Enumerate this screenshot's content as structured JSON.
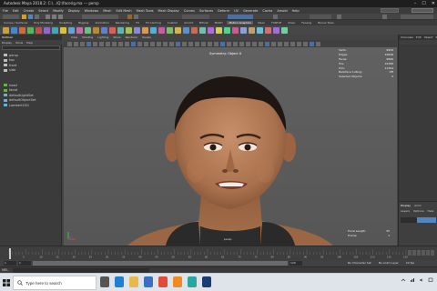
{
  "titlebar": {
    "title": "Autodesk Maya 2018.2: C:\\...\\Q:\\facerig.ma  ---  persp",
    "controls": [
      "–",
      "☐",
      "✕"
    ]
  },
  "menubar": {
    "items": [
      "File",
      "Edit",
      "Create",
      "Select",
      "Modify",
      "Display",
      "Windows",
      "Mesh",
      "Edit Mesh",
      "Mesh Tools",
      "Mesh Display",
      "Curves",
      "Surfaces",
      "Deform",
      "UV",
      "Generate",
      "Cache",
      "Arnold",
      "Help"
    ]
  },
  "shelf": {
    "tabs": [
      "Curves / Surfaces",
      "Poly Modeling",
      "Sculpting",
      "Rigging",
      "Animation",
      "Rendering",
      "FX",
      "FX Caching",
      "Custom",
      "Arnold",
      "Bifrost",
      "MASH",
      "Motion Graphics",
      "XGen",
      "TURTLE",
      "XGen",
      "Facerig",
      "Bonus Tools"
    ],
    "active_index": 12,
    "icon_colors": [
      "#c9a13c",
      "#4a86c8",
      "#d06a3a",
      "#5db25d",
      "#c44c4c",
      "#8c6bc7",
      "#3fa7b5",
      "#d8c04a",
      "#6aa0d8",
      "#c06fa8",
      "#6cbf8a",
      "#b8893d",
      "#5f7fd2",
      "#d65f5f",
      "#5bb7a6",
      "#a8c05a",
      "#8a8ad4",
      "#d49a5a",
      "#4fb0d9",
      "#c45fa0",
      "#7ec06a",
      "#d0b45a",
      "#5a8fd0",
      "#c0705a",
      "#6fc0b0",
      "#b06fd0",
      "#d0d05a",
      "#5ad08f",
      "#d05a8f",
      "#8fa0d0",
      "#c0a070",
      "#70c0d0",
      "#d07070",
      "#a070d0",
      "#70d0a0"
    ]
  },
  "outliner": {
    "tabs": [
      "Outliner",
      "Display",
      "Show",
      "Help"
    ],
    "menu": [
      "Display",
      "Show",
      "Help"
    ],
    "items": [
      {
        "label": "persp",
        "icon": "camera-icon",
        "color": "#bbbbbb"
      },
      {
        "label": "top",
        "icon": "camera-icon",
        "color": "#bbbbbb"
      },
      {
        "label": "front",
        "icon": "camera-icon",
        "color": "#bbbbbb"
      },
      {
        "label": "side",
        "icon": "camera-icon",
        "color": "#bbbbbb"
      },
      {
        "label": "",
        "icon": "blank",
        "color": "#bbbbbb"
      },
      {
        "label": "",
        "icon": "blank",
        "color": "#bbbbbb"
      },
      {
        "label": "head",
        "icon": "mesh-icon",
        "color": "#6ab04c"
      },
      {
        "label": "facial",
        "icon": "mesh-icon",
        "color": "#6ab04c"
      },
      {
        "label": "defaultLightSet",
        "icon": "set-icon",
        "color": "#5db6d9"
      },
      {
        "label": "defaultObjectSet",
        "icon": "set-icon",
        "color": "#5db6d9"
      },
      {
        "label": "Lambert1SG",
        "icon": "set-icon",
        "color": "#5db6d9"
      }
    ]
  },
  "viewport": {
    "menu": [
      "View",
      "Shading",
      "Lighting",
      "Show",
      "Renderer",
      "Panels"
    ],
    "camera_label": "Symmetry: Object X",
    "persp_label": "persp",
    "hud_top": [
      {
        "k": "Verts:",
        "v": "9956"
      },
      {
        "k": "Edges:",
        "v": "19848"
      },
      {
        "k": "Faces:",
        "v": "9896"
      },
      {
        "k": "Tris:",
        "v": "19788"
      },
      {
        "k": "UVs:",
        "v": "11304"
      },
      {
        "k": "Backface Culling:",
        "v": "Off"
      },
      {
        "k": "Selected Objects:",
        "v": "0"
      }
    ],
    "hud_bottom": [
      {
        "k": "Focal Length:",
        "v": "35"
      },
      {
        "k": "Frame:",
        "v": "1"
      }
    ]
  },
  "attr_panel": {
    "tabs": [
      "Channels",
      "Edit",
      "Object",
      "Show"
    ],
    "layer_tabs": [
      "Display",
      "Anim"
    ],
    "layer_menu": [
      "Layers",
      "Options",
      "Help"
    ]
  },
  "timeslider": {
    "tick_labels": [
      "1",
      "5",
      "10",
      "15",
      "20",
      "25",
      "30",
      "35",
      "40",
      "45",
      "50",
      "55",
      "60",
      "65",
      "70",
      "75",
      "80",
      "85",
      "90",
      "95",
      "100",
      "105",
      "110",
      "115",
      "120"
    ],
    "current_frame": "1"
  },
  "rangeslider": {
    "start": "1",
    "start2": "1",
    "end": "120",
    "character_set": "No Character Set",
    "anim_layer": "No Anim Layer",
    "fps": "24 fps"
  },
  "mel": {
    "label": "MEL"
  },
  "taskbar": {
    "search_placeholder": "Type here to search",
    "apps": [
      {
        "name": "task-view-icon",
        "color": "#555555"
      },
      {
        "name": "edge-icon",
        "color": "#1f7fd1"
      },
      {
        "name": "file-explorer-icon",
        "color": "#e8b84a"
      },
      {
        "name": "store-icon",
        "color": "#3a6fc4"
      },
      {
        "name": "chrome-icon",
        "color": "#e04b3a"
      },
      {
        "name": "firefox-icon",
        "color": "#f08a24"
      },
      {
        "name": "maya-icon",
        "color": "#2aa6a0"
      },
      {
        "name": "photoshop-icon",
        "color": "#1b3b74"
      }
    ]
  }
}
